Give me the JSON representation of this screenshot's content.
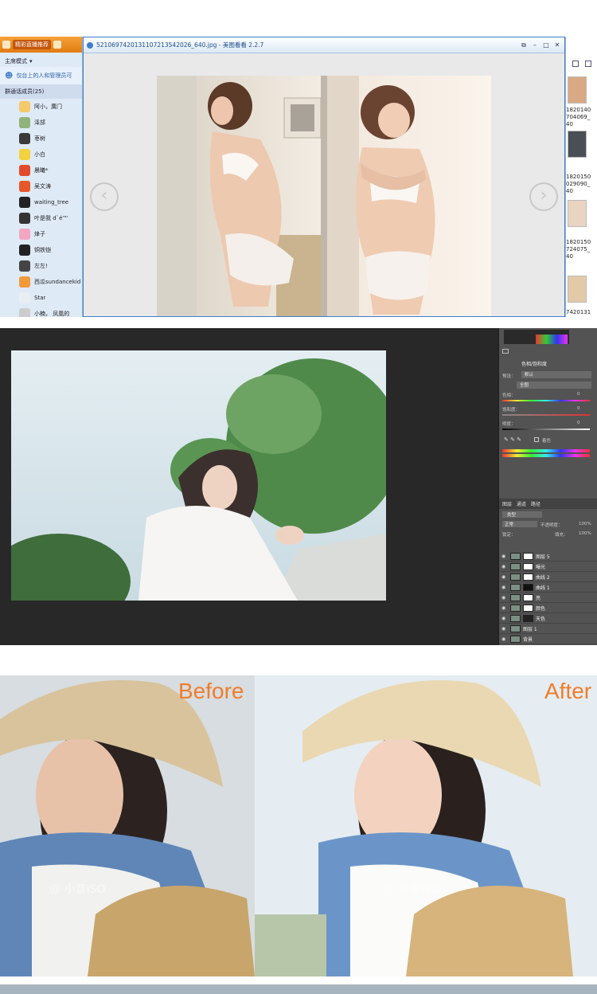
{
  "qq": {
    "live_button": "精彩直播推荐",
    "mode": "主席模式",
    "online_text": "仅台上的人和管理员可",
    "group_title": "群通话成员(25)",
    "members": [
      {
        "name": "阿小，廣门",
        "color": "#f6c96b"
      },
      {
        "name": "泽邡",
        "color": "#8fb37a"
      },
      {
        "name": "枣树",
        "color": "#3a3a3a"
      },
      {
        "name": "小白",
        "color": "#f4d23e"
      },
      {
        "name": "晨曦*",
        "color": "#e24a2c"
      },
      {
        "name": "吴文涛",
        "color": "#e6582a"
      },
      {
        "name": "waiting_tree",
        "color": "#222222"
      },
      {
        "name": "叶是我 d`é'\"'",
        "color": "#333333"
      },
      {
        "name": "烽子",
        "color": "#f2a6c0"
      },
      {
        "name": "铜铁铠",
        "color": "#222222"
      },
      {
        "name": "左左!",
        "color": "#444444"
      },
      {
        "name": "西瓜sundancekid",
        "color": "#f29a3a"
      },
      {
        "name": "Star",
        "color": "#e9eef2"
      },
      {
        "name": "小楠，   凤凰的",
        "color": "#cccccc"
      }
    ]
  },
  "viewer": {
    "title": "52106974201311072135420​26_640.jpg - 美图看看 2.2.7",
    "prev_icon": "arrow-left-icon",
    "next_icon": "arrow-right-icon"
  },
  "thumbs": [
    {
      "caption": [
        "1820140",
        "704069_",
        "40"
      ]
    },
    {
      "caption": [
        "1820150",
        "029090_",
        "40"
      ]
    },
    {
      "caption": [
        "1820150",
        "724075_",
        "40"
      ]
    },
    {
      "caption": [
        "7420131"
      ]
    }
  ],
  "editor": {
    "adjust_title": "色相/饱和度",
    "preset_label": "预设：",
    "preset_value": "默认",
    "channel_value": "全图",
    "hue_label": "色相：",
    "hue_value": "0",
    "sat_label": "饱和度：",
    "sat_value": "0",
    "light_label": "明度：",
    "light_value": "0",
    "colorize_label": "着色",
    "tabs": [
      "图层",
      "通道",
      "路径"
    ],
    "kind_label": "类型",
    "blend_mode": "正常",
    "opacity_label": "不透明度：",
    "opacity_value": "100%",
    "lock_label": "锁定：",
    "fill_label": "填充：",
    "fill_value": "100%",
    "layers": [
      {
        "name": "图层 5",
        "mask": "#ffffff"
      },
      {
        "name": "曝光",
        "mask": "#ffffff"
      },
      {
        "name": "曲线 2",
        "mask": "#ffffff"
      },
      {
        "name": "曲线 1",
        "mask": "#111111"
      },
      {
        "name": "亮",
        "mask": "#ffffff"
      },
      {
        "name": "颜色",
        "mask": "#ffffff"
      },
      {
        "name": "天色",
        "mask": "#222222"
      },
      {
        "name": "图层 1",
        "mask": ""
      },
      {
        "name": "背景",
        "mask": ""
      }
    ]
  },
  "compare": {
    "before_label": "Before",
    "after_label": "After",
    "watermark": "@ 小昔ISO"
  },
  "colors": {
    "accent_orange": "#f07d2a",
    "qq_orange": "#e07b12",
    "viewer_blue": "#3d7fc9",
    "editor_bg": "#282828"
  }
}
